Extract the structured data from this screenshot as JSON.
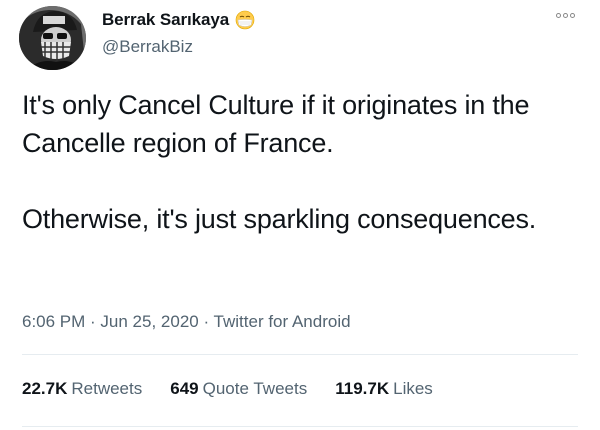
{
  "author": {
    "display_name": "Berrak Sarıkaya",
    "handle": "@BerrakBiz",
    "avatar_icon": "profile-photo",
    "badge_icon": "face-with-medical-mask-emoji"
  },
  "tweet": {
    "paragraphs": [
      "It's only Cancel Culture if it originates in the Cancelle region of France.",
      "Otherwise, it's just sparkling consequences."
    ],
    "time": "6:06 PM",
    "date": "Jun 25, 2020",
    "source": "Twitter for Android",
    "separator": " · "
  },
  "stats": {
    "retweets_count": "22.7K",
    "retweets_label": "Retweets",
    "quotes_count": "649",
    "quotes_label": "Quote Tweets",
    "likes_count": "119.7K",
    "likes_label": "Likes"
  },
  "colors": {
    "text": "#0f1419",
    "secondary": "#536471",
    "divider": "#e6ecf0"
  }
}
